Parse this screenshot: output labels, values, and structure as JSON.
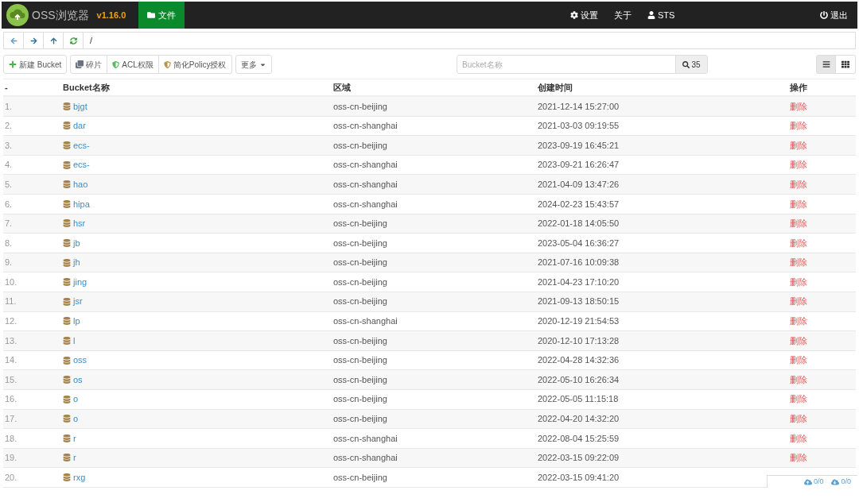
{
  "header": {
    "app_name": "OSS浏览器",
    "version": "v1.16.0",
    "tabs": [
      {
        "label": "文件",
        "selected": true
      }
    ],
    "menu": [
      {
        "kind": "settings",
        "label": "设置"
      },
      {
        "kind": "about",
        "label": "关于"
      },
      {
        "kind": "user",
        "label": "STS"
      },
      {
        "kind": "logout",
        "label": "退出"
      }
    ]
  },
  "address_bar": {
    "path": "/"
  },
  "toolbar": {
    "buttons": [
      {
        "kind": "add",
        "label": "新建 Bucket"
      },
      {
        "kind": "fragments",
        "label": "碎片"
      },
      {
        "kind": "acl",
        "label": "ACL权限"
      },
      {
        "kind": "policy",
        "label": "简化Policy授权"
      },
      {
        "kind": "more",
        "label": "更多"
      }
    ],
    "search": {
      "placeholder": "Bucket名称",
      "count": "35"
    },
    "views": [
      {
        "kind": "list",
        "selected": true
      },
      {
        "kind": "grid",
        "selected": false
      }
    ]
  },
  "table": {
    "columns": [
      "-",
      "Bucket名称",
      "区域",
      "创建时间",
      "操作"
    ],
    "rows": [
      {
        "index": "1.",
        "name": "bjgt",
        "region": "oss-cn-beijing",
        "created": "2021-12-14 15:27:00",
        "action": "删除"
      },
      {
        "index": "2.",
        "name": "dar",
        "region": "oss-cn-shanghai",
        "created": "2021-03-03 09:19:55",
        "action": "删除"
      },
      {
        "index": "3.",
        "name": "ecs-",
        "region": "oss-cn-beijing",
        "created": "2023-09-19 16:45:21",
        "action": "删除"
      },
      {
        "index": "4.",
        "name": "ecs-",
        "region": "oss-cn-shanghai",
        "created": "2023-09-21 16:26:47",
        "action": "删除"
      },
      {
        "index": "5.",
        "name": "hao",
        "region": "oss-cn-shanghai",
        "created": "2021-04-09 13:47:26",
        "action": "删除"
      },
      {
        "index": "6.",
        "name": "hipa",
        "region": "oss-cn-shanghai",
        "created": "2024-02-23 15:43:57",
        "action": "删除"
      },
      {
        "index": "7.",
        "name": "hsr",
        "region": "oss-cn-beijing",
        "created": "2022-01-18 14:05:50",
        "action": "删除"
      },
      {
        "index": "8.",
        "name": "jb",
        "region": "oss-cn-beijing",
        "created": "2023-05-04 16:36:27",
        "action": "删除"
      },
      {
        "index": "9.",
        "name": "jh",
        "region": "oss-cn-beijing",
        "created": "2021-07-16 10:09:38",
        "action": "删除"
      },
      {
        "index": "10.",
        "name": "jing",
        "region": "oss-cn-beijing",
        "created": "2021-04-23 17:10:20",
        "action": "删除"
      },
      {
        "index": "11.",
        "name": "jsr",
        "region": "oss-cn-beijing",
        "created": "2021-09-13 18:50:15",
        "action": "删除"
      },
      {
        "index": "12.",
        "name": "lp",
        "region": "oss-cn-shanghai",
        "created": "2020-12-19 21:54:53",
        "action": "删除"
      },
      {
        "index": "13.",
        "name": "l",
        "region": "oss-cn-beijing",
        "created": "2020-12-10 17:13:28",
        "action": "删除"
      },
      {
        "index": "14.",
        "name": "oss",
        "region": "oss-cn-beijing",
        "created": "2022-04-28 14:32:36",
        "action": "删除"
      },
      {
        "index": "15.",
        "name": "os",
        "region": "oss-cn-beijing",
        "created": "2022-05-10 16:26:34",
        "action": "删除"
      },
      {
        "index": "16.",
        "name": "o",
        "region": "oss-cn-beijing",
        "created": "2022-05-05 11:15:18",
        "action": "删除"
      },
      {
        "index": "17.",
        "name": "o",
        "region": "oss-cn-beijing",
        "created": "2022-04-20 14:32:20",
        "action": "删除"
      },
      {
        "index": "18.",
        "name": "r",
        "region": "oss-cn-shanghai",
        "created": "2022-08-04 15:25:59",
        "action": "删除"
      },
      {
        "index": "19.",
        "name": "r",
        "region": "oss-cn-shanghai",
        "created": "2022-03-15 09:22:09",
        "action": "删除"
      },
      {
        "index": "20.",
        "name": "rxg",
        "region": "oss-cn-beijing",
        "created": "2022-03-15 09:41:20"
      }
    ]
  },
  "transfer_status": [
    {
      "kind": "upload",
      "label": "0/0"
    },
    {
      "kind": "download",
      "label": "0/0"
    }
  ]
}
